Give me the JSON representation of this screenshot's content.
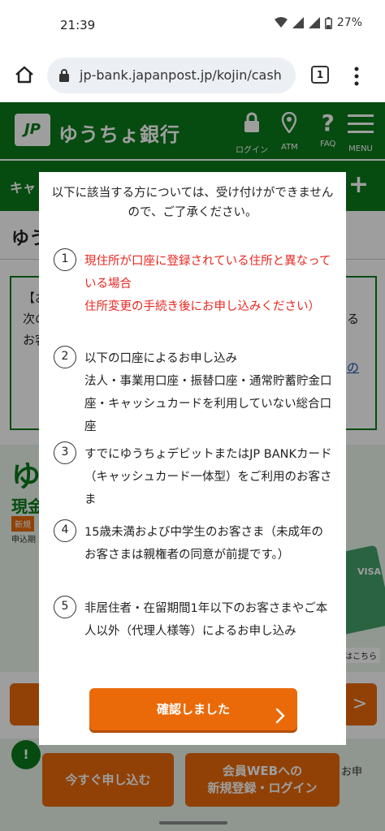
{
  "status_bar": {
    "time": "21:39",
    "battery": "27%"
  },
  "browser": {
    "url": "jp-bank.japanpost.jp/kojin/cash",
    "tab_count": "1"
  },
  "site_header": {
    "logo_mark": "JP",
    "logo_text": "ゆうちょ銀行",
    "icons": [
      {
        "name": "login",
        "label": "ログイン"
      },
      {
        "name": "atm",
        "label": "ATM"
      },
      {
        "name": "faq",
        "label": "FAQ"
      },
      {
        "name": "menu",
        "label": "MENU"
      }
    ]
  },
  "sub_nav": {
    "left_text": "キャ",
    "plus": "+"
  },
  "page_title": "ゆう",
  "background": {
    "notice_l1": "【お",
    "notice_l2": "次の",
    "notice_l3": "お客",
    "notice_r1": "る",
    "notice_r2": "の",
    "promo_big": "ゆ",
    "promo_mid": "現金",
    "promo_tag": "新規",
    "promo_small": "申込期",
    "promo_card": "VISA",
    "promo_link": "はこちら",
    "chat": "!",
    "bottom_note_right": "お申",
    "arrow": ">"
  },
  "bottom_buttons": {
    "apply_now": "今すぐ申し込む",
    "member_line1": "会員WEBへの",
    "member_line2": "新規登録・ログイン"
  },
  "modal": {
    "intro": "以下に該当する方については、受け付けができませんので、ご了承ください。",
    "items": [
      {
        "number": "1",
        "lines": [
          "現住所が口座に登録されている住所と異なっている場合",
          "住所変更の手続き後にお申し込みください）"
        ],
        "color": "#e8261f"
      },
      {
        "number": "2",
        "lines": [
          "以下の口座によるお申し込み",
          "法人・事業用口座・振替口座・通常貯蓄貯金口座・キャッシュカードを利用していない総合口座"
        ]
      },
      {
        "number": "3",
        "lines": [
          "すでにゆうちょデビットまたはJP BANKカード（キャッシュカード一体型）をご利用のお客さま"
        ]
      },
      {
        "number": "4",
        "lines": [
          "15歳未満および中学生のお客さま（未成年のお客さまは親権者の同意が前提です。）"
        ]
      },
      {
        "number": "5",
        "lines": [
          "非居住者・在留期間1年以下のお客さまやご本人以外（代理人様等）によるお申し込み"
        ]
      }
    ],
    "confirm_label": "確認しました"
  },
  "colors": {
    "brand_green": "#0a7a1a",
    "accent_orange": "#ea6a0a",
    "warning_red": "#e8261f"
  }
}
